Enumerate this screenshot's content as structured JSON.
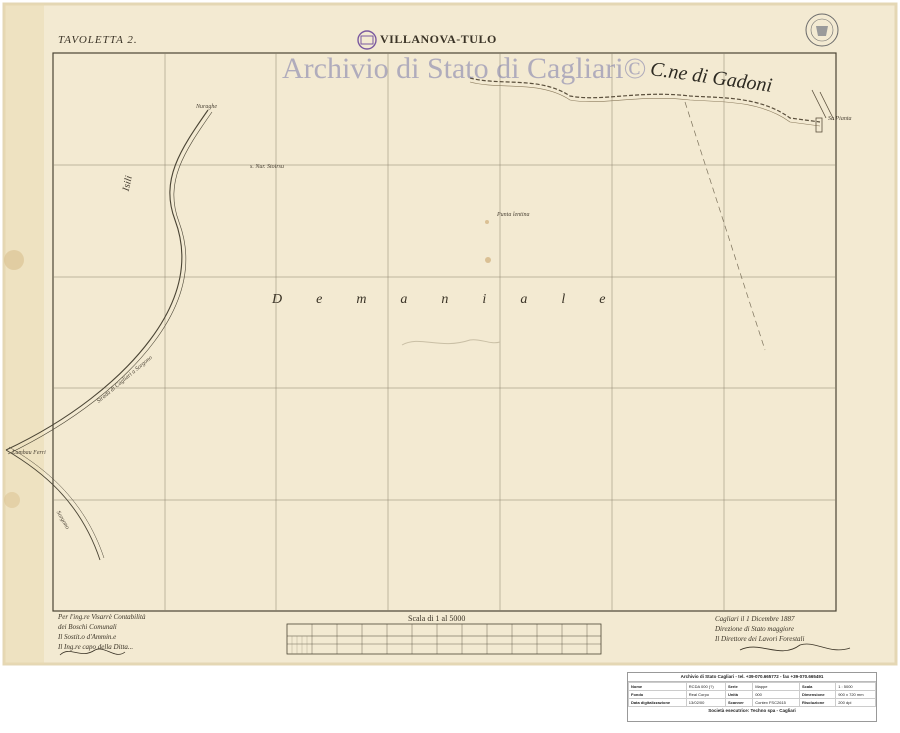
{
  "sheet": {
    "tavoletta_label": "TAVOLETTA 2.",
    "title": "VILLANOVA-TULO",
    "watermark": "Archivio di Stato di Cagliari©",
    "regions": {
      "gadoni": "C.ne di Gadoni",
      "demaniale": "Demaniale",
      "isili": "Isili"
    },
    "place_labels": {
      "nuraghe_stoirsu": "s. Nur. Stoirsu",
      "punta_lentina": "Punta lentina",
      "sa_pianta": "Sa Pianta",
      "nuraghe_top": "Nuraghe",
      "strada": "Strada di Cagliari a Sorgono",
      "lumbau_ferri": "Lumbau Ferri",
      "sorgono": "Sorgono",
      "scale_label": "Scala di 1 al 5000"
    },
    "notes": {
      "left": [
        "Per l'ing.re Visarrè Contabilità",
        "dei Boschi Comunali",
        "Il Sostit.o d'Ammin.e",
        "Il Ing.re capo della Ditta..."
      ],
      "right": [
        "Cagliari il 1 Dicembre 1887",
        "Direzione di Stato maggiore",
        "Il Direttore dei Lavori Forestali"
      ]
    },
    "colors": {
      "paper": "#f4ecd5",
      "grid": "#8a826c",
      "ink": "#3a3326",
      "watermark": "#8c8cc0"
    }
  },
  "footer": {
    "archive": "Archivio di Stato Cagliari - tel. +39-070.665772 - fax +39-070.665491",
    "rows": [
      [
        "Nome",
        "RCDA 000 (?)",
        "Serie",
        "Mappe",
        "Scala",
        "1 : 5000"
      ],
      [
        "Fondo",
        "Real Corpo",
        "Unità",
        "000",
        "Dimensione",
        "900 x 720 mm"
      ],
      [
        "Data digitalizzazione",
        "13/02/00",
        "Scanner",
        "Contex FSC2615",
        "Risoluzione",
        "200 dpi"
      ]
    ],
    "executor": "Società esecutrice: Techno spa - Cagliari"
  }
}
